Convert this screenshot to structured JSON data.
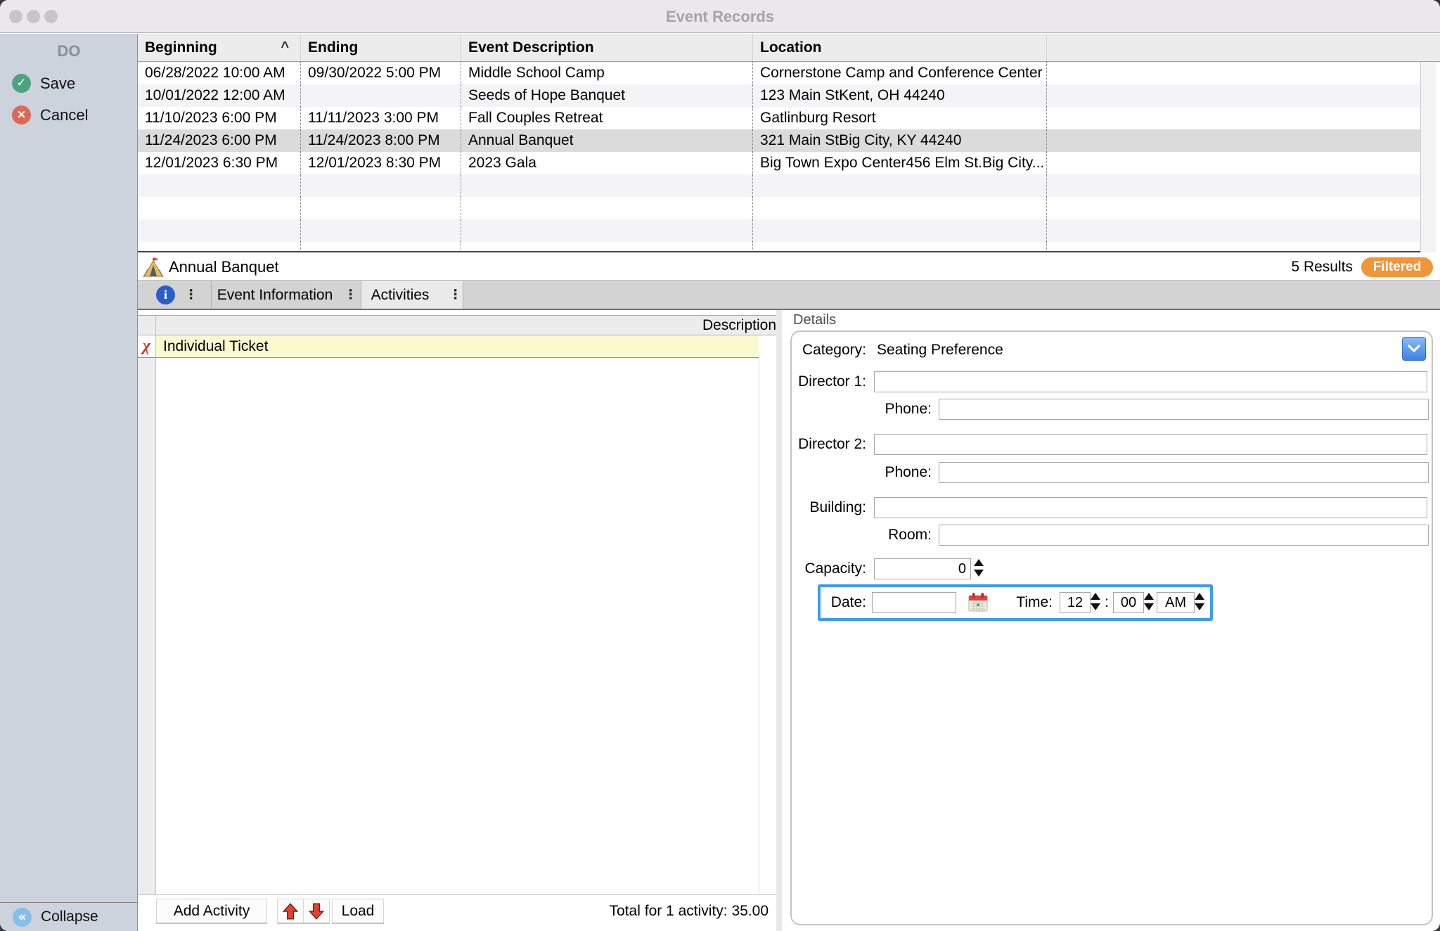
{
  "window": {
    "title": "Event Records"
  },
  "sidebar": {
    "header": "DO",
    "save_label": "Save",
    "cancel_label": "Cancel",
    "collapse_label": "Collapse"
  },
  "table": {
    "columns": [
      "Beginning",
      "Ending",
      "Event Description",
      "Location"
    ],
    "sort_indicator": "^",
    "rows": [
      {
        "beginning": "06/28/2022 10:00 AM",
        "ending": "09/30/2022 5:00 PM",
        "description": "Middle School Camp",
        "location": "Cornerstone Camp and Conference Center",
        "selected": false
      },
      {
        "beginning": "10/01/2022 12:00 AM",
        "ending": "",
        "description": "Seeds of Hope Banquet",
        "location": "123 Main StKent, OH 44240",
        "selected": false
      },
      {
        "beginning": "11/10/2023 6:00 PM",
        "ending": "11/11/2023 3:00 PM",
        "description": "Fall Couples Retreat",
        "location": "Gatlinburg Resort",
        "selected": false
      },
      {
        "beginning": "11/24/2023 6:00 PM",
        "ending": "11/24/2023 8:00 PM",
        "description": "Annual Banquet",
        "location": "321 Main StBig City, KY 44240",
        "selected": true
      },
      {
        "beginning": "12/01/2023 6:30 PM",
        "ending": "12/01/2023 8:30 PM",
        "description": "2023 Gala",
        "location": "Big Town Expo Center456 Elm St.Big City...",
        "selected": false
      }
    ]
  },
  "record_bar": {
    "title": "Annual Banquet",
    "results_count": "5 Results",
    "filter_badge": "Filtered"
  },
  "tabs": [
    {
      "label": "Event Information",
      "active": false
    },
    {
      "label": "Activities",
      "active": true
    }
  ],
  "activities": {
    "column_header": "Description",
    "rows": [
      {
        "description": "Individual Ticket"
      }
    ],
    "footer": {
      "add_button": "Add Activity",
      "load_button": "Load",
      "total": "Total for 1 activity: 35.00"
    }
  },
  "details": {
    "panel_title": "Details",
    "category_label": "Category:",
    "category_value": "Seating Preference",
    "director1_label": "Director 1:",
    "phone1_label": "Phone:",
    "director2_label": "Director 2:",
    "phone2_label": "Phone:",
    "building_label": "Building:",
    "room_label": "Room:",
    "capacity_label": "Capacity:",
    "capacity_value": "0",
    "date_label": "Date:",
    "date_value": "",
    "time_label": "Time:",
    "time_separator": ":",
    "hour_value": "12",
    "minute_value": "00",
    "meridiem_value": "AM",
    "inputs": {
      "director1": "",
      "phone1": "",
      "director2": "",
      "phone2": "",
      "building": "",
      "room": ""
    }
  },
  "icons": {
    "save": "check-in-green-circle",
    "cancel": "x-in-red-circle",
    "collapse": "double-left-chevron-in-blue-circle",
    "record": "tent-icon",
    "info": "i-in-blue-circle",
    "delete_activity": "red-cut-glyph",
    "date_picker": "calendar-icon",
    "move_up": "red-up-arrow",
    "move_down": "red-down-arrow",
    "category_dropdown": "white-chevron-on-blue"
  },
  "colors": {
    "accent_blue": "#3d9bf3",
    "badge_orange": "#f0953a",
    "save_green": "#4ba380",
    "cancel_red": "#d96a58",
    "collapse_blue": "#84bfe9",
    "selected_row": "#dbdbdb",
    "highlight_yellow": "#fcf9d0",
    "sidebar_bg": "#cdd3dd",
    "titlebar_bg": "#ebe7eb"
  }
}
